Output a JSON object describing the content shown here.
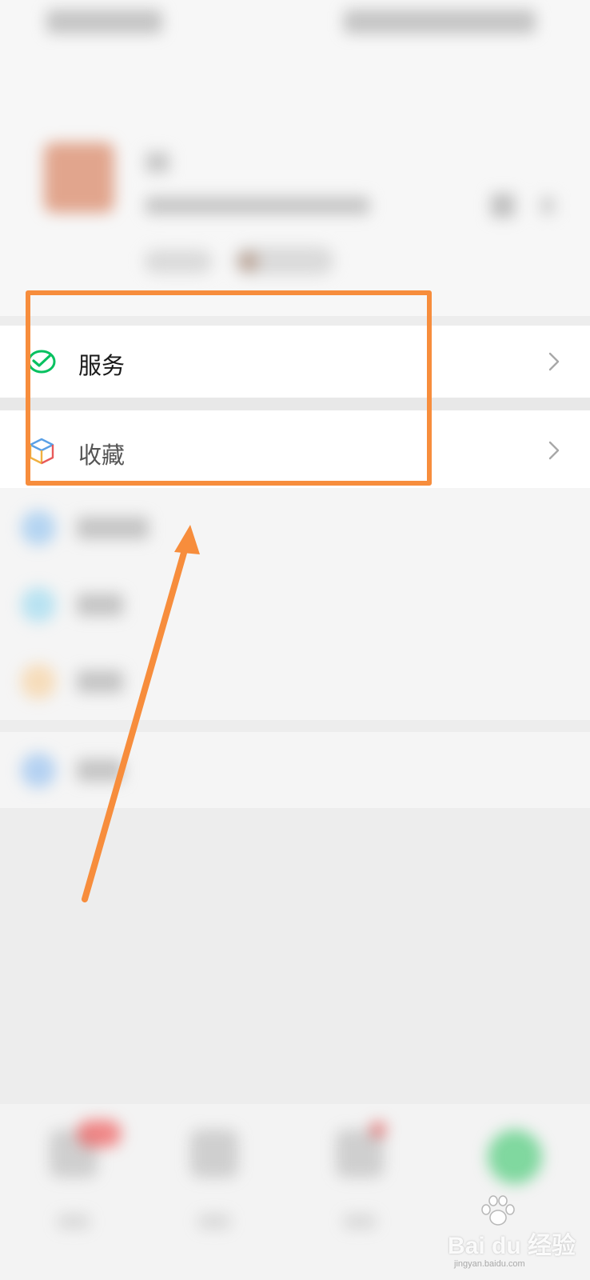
{
  "menu": {
    "items": [
      {
        "label": "服务",
        "icon": "wechat-pay-icon"
      },
      {
        "label": "收藏",
        "icon": "favorites-cube-icon"
      }
    ]
  },
  "annotation": {
    "color": "#f78d3c"
  },
  "watermark": {
    "brand": "Bai  du 经验",
    "domain": "jingyan.baidu.com"
  },
  "colors": {
    "wechat_green": "#07c160",
    "background": "#ededed"
  }
}
